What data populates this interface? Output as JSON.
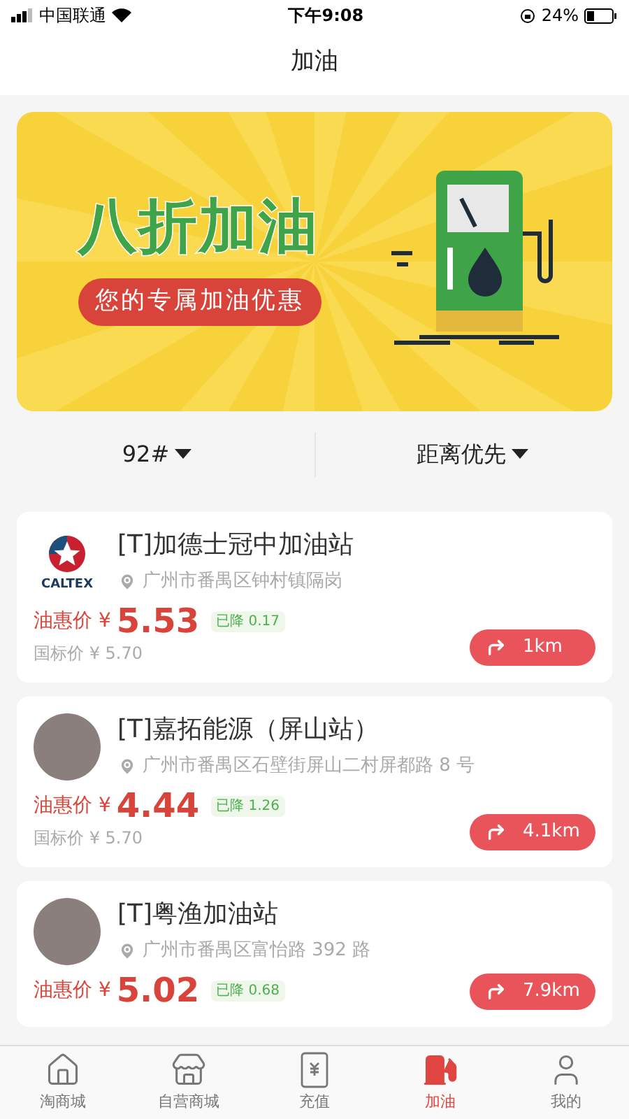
{
  "status_bar": {
    "carrier": "中国联通",
    "time": "下午9:08",
    "battery": "24%"
  },
  "header": {
    "title": "加油"
  },
  "banner": {
    "headline": "八折加油",
    "subtitle": "您的专属加油优惠"
  },
  "filters": [
    {
      "label": "92#"
    },
    {
      "label": "距离优先"
    }
  ],
  "stations": [
    {
      "kind": "brand",
      "brand_text": "CALTEX",
      "name": "[T]加德士冠中加油站",
      "address": "广州市番禺区钟村镇隔岗",
      "price_label": "油惠价 ¥",
      "price": "5.53",
      "discount": "已降 0.17",
      "standard_price": "国标价 ¥ 5.70",
      "distance": "1km"
    },
    {
      "kind": "photo",
      "name": "[T]嘉拓能源（屏山站）",
      "address": "广州市番禺区石壁街屏山二村屏都路 8 号",
      "price_label": "油惠价 ¥",
      "price": "4.44",
      "discount": "已降 1.26",
      "standard_price": "国标价 ¥ 5.70",
      "distance": "4.1km"
    },
    {
      "kind": "photo",
      "name": "[T]粤渔加油站",
      "address": "广州市番禺区富怡路 392 路",
      "price_label": "油惠价 ¥",
      "price": "5.02",
      "discount": "已降 0.68",
      "distance": "7.9km"
    }
  ],
  "tabs": [
    {
      "label": "淘商城",
      "kind": "home",
      "selected": false
    },
    {
      "label": "自营商城",
      "kind": "store",
      "selected": false
    },
    {
      "label": "充值",
      "kind": "recharge",
      "selected": false
    },
    {
      "label": "加油",
      "kind": "fuel",
      "selected": true
    },
    {
      "label": "我的",
      "kind": "user",
      "selected": false
    }
  ]
}
